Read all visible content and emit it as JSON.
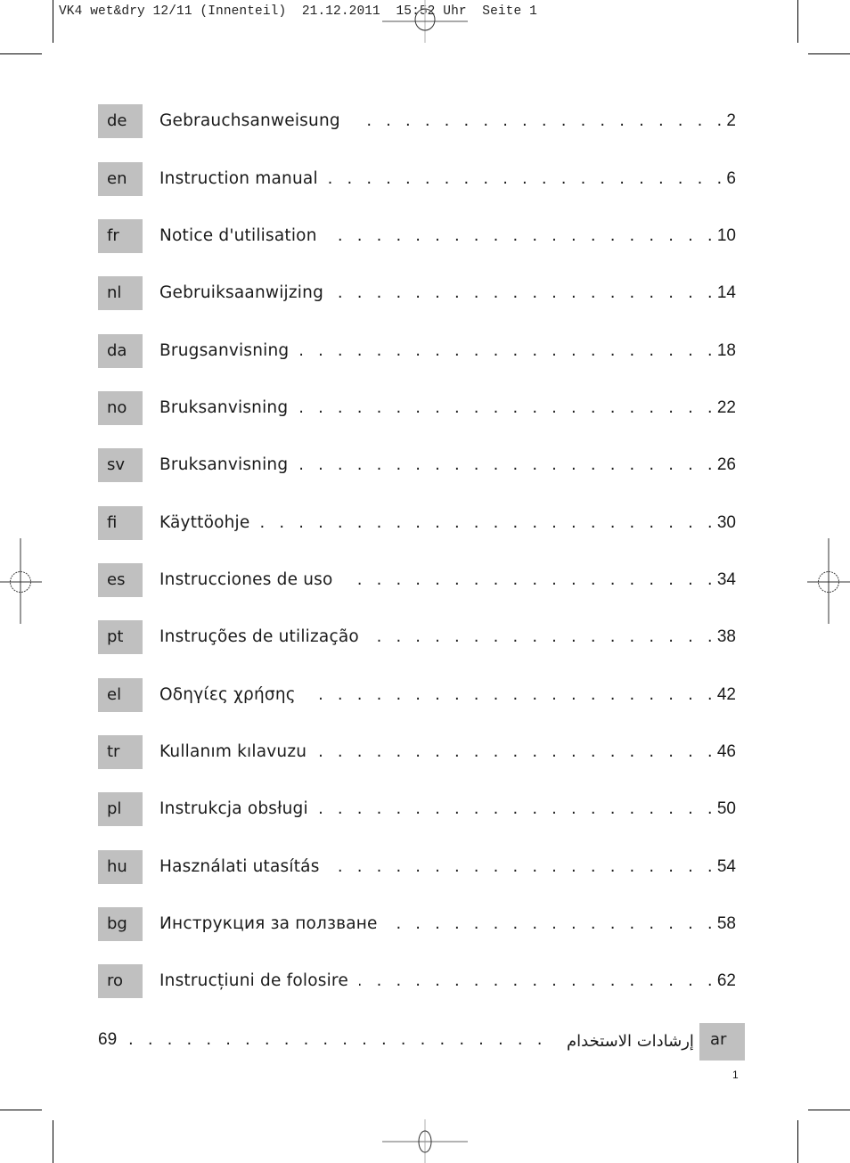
{
  "slug_line": "VK4 wet&dry 12/11 (Innenteil)  21.12.2011  15:52 Uhr  Seite 1",
  "toc": {
    "entries": [
      {
        "code": "de",
        "title": "Gebrauchsanweisung",
        "page": "2"
      },
      {
        "code": "en",
        "title": "Instruction manual",
        "page": "6"
      },
      {
        "code": "fr",
        "title": "Notice d'utilisation",
        "page": "10"
      },
      {
        "code": "nl",
        "title": "Gebruiksaanwijzing",
        "page": "14"
      },
      {
        "code": "da",
        "title": "Brugsanvisning",
        "page": "18"
      },
      {
        "code": "no",
        "title": "Bruksanvisning",
        "page": "22"
      },
      {
        "code": "sv",
        "title": "Bruksanvisning",
        "page": "26"
      },
      {
        "code": "fi",
        "title": "Käyttöohje",
        "page": "30"
      },
      {
        "code": "es",
        "title": "Instrucciones de uso",
        "page": "34"
      },
      {
        "code": "pt",
        "title": "Instruções de utilização",
        "page": "38"
      },
      {
        "code": "el",
        "title": "Οδηγίες χρήσης",
        "page": "42"
      },
      {
        "code": "tr",
        "title": "Kullanım kılavuzu",
        "page": "46"
      },
      {
        "code": "pl",
        "title": "Instrukcja obsługi",
        "page": "50"
      },
      {
        "code": "hu",
        "title": "Használati utasítás",
        "page": "54"
      },
      {
        "code": "bg",
        "title": "Инструкция за ползване",
        "page": "58"
      },
      {
        "code": "ro",
        "title": "Instrucțiuni de folosire",
        "page": "62"
      }
    ],
    "rtl_entry": {
      "code": "ar",
      "title": "إرشادات الاستخدام",
      "page": "69"
    },
    "leader_dots": ". . . . . . . . . . . . . . . . . . . . . . . . . . . . . . . . . . . . . . . . . . . . . . . . . . . . . . ."
  },
  "page_number": "1"
}
